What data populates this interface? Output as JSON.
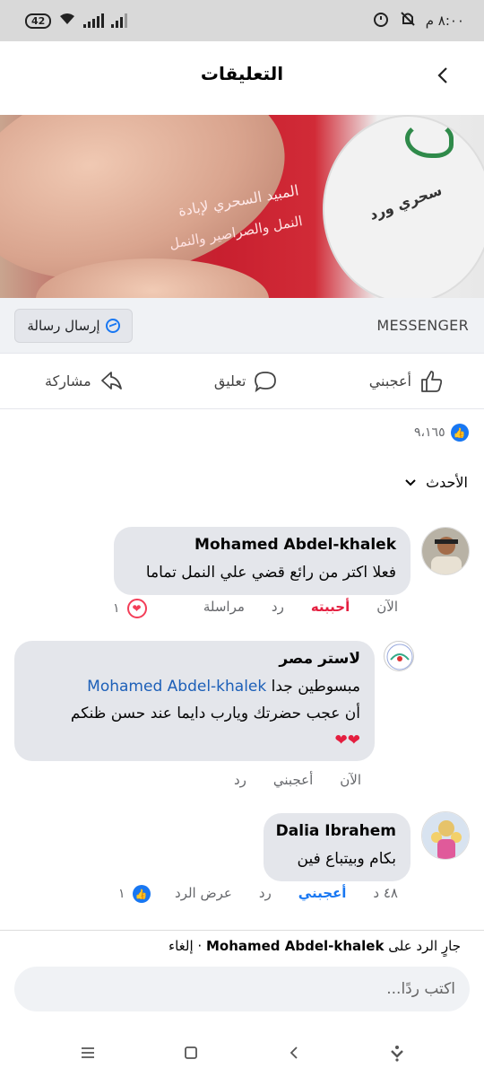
{
  "status_bar": {
    "battery": "42",
    "time": "٨:٠٠ م"
  },
  "header": {
    "title": "التعليقات"
  },
  "messenger_bar": {
    "brand": "MESSENGER",
    "send_label": "إرسال رسالة"
  },
  "media": {
    "line1": "المبيد السحري لإبادة",
    "line2": "النمل والصراصير والنمل",
    "sticker_text": "سحري ورد"
  },
  "actions": {
    "like": "أعجبني",
    "comment": "تعليق",
    "share": "مشاركة"
  },
  "reactions": {
    "count": "٩،١٦٥"
  },
  "sort": {
    "label": "الأحدث"
  },
  "comments": [
    {
      "name": "Mohamed Abdel-khalek",
      "text": "فعلا اكتر من رائع قضي علي النمل تماما",
      "time": "الآن",
      "reaction_label": "أحببته",
      "reply": "رد",
      "message": "مراسلة",
      "reaction_count": "١"
    },
    {
      "name": "لاستر مصر",
      "text_prefix": "مبسوطين جدا",
      "mention": "Mohamed Abdel-khalek",
      "text_line2": "أن عجب حضرتك ويارب دايما عند حسن ظنكم",
      "hearts": "❤❤",
      "time": "الآن",
      "like": "أعجبني",
      "reply": "رد"
    },
    {
      "name": "Dalia Ibrahem",
      "text": "بكام وبيتباع فين",
      "time": "٤٨ د",
      "like": "أعجبني",
      "reply": "رد",
      "view_reply": "عرض الرد",
      "reaction_count": "١"
    }
  ],
  "reply_bar": {
    "replying_prefix": "جارٍ الرد على",
    "replying_name": "Mohamed Abdel-khalek",
    "cancel": " · إلغاء",
    "placeholder": "اكتب ردًا..."
  },
  "colors": {
    "facebook_blue": "#1877f2",
    "love_red": "#e41e3f",
    "bubble_gray": "#e4e6eb"
  }
}
